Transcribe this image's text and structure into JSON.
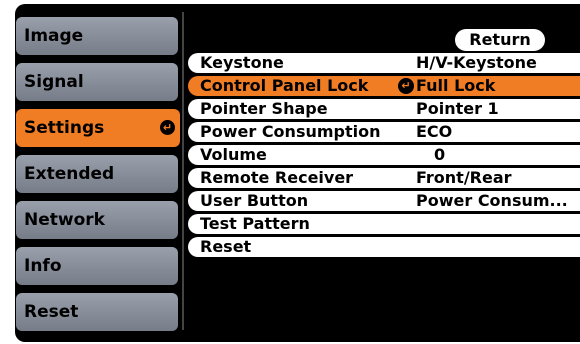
{
  "menu": {
    "items": [
      {
        "label": "Image"
      },
      {
        "label": "Signal"
      },
      {
        "label": "Settings"
      },
      {
        "label": "Extended"
      },
      {
        "label": "Network"
      },
      {
        "label": "Info"
      },
      {
        "label": "Reset"
      }
    ],
    "active_index": 2
  },
  "header": {
    "return_label": "Return"
  },
  "settings": {
    "rows": [
      {
        "label": "Keystone",
        "value": "H/V-Keystone"
      },
      {
        "label": "Control Panel Lock",
        "value": "Full Lock"
      },
      {
        "label": "Pointer Shape",
        "value": "Pointer 1"
      },
      {
        "label": "Power Consumption",
        "value": "ECO"
      },
      {
        "label": "Volume",
        "value": "0"
      },
      {
        "label": "Remote Receiver",
        "value": "Front/Rear"
      },
      {
        "label": "User Button",
        "value": "Power Consum..."
      },
      {
        "label": "Test Pattern",
        "value": ""
      },
      {
        "label": "Reset",
        "value": ""
      }
    ],
    "active_index": 1
  },
  "colors": {
    "accent": "#f07c24",
    "menu_bg": "#8a909b",
    "background": "#000000"
  }
}
